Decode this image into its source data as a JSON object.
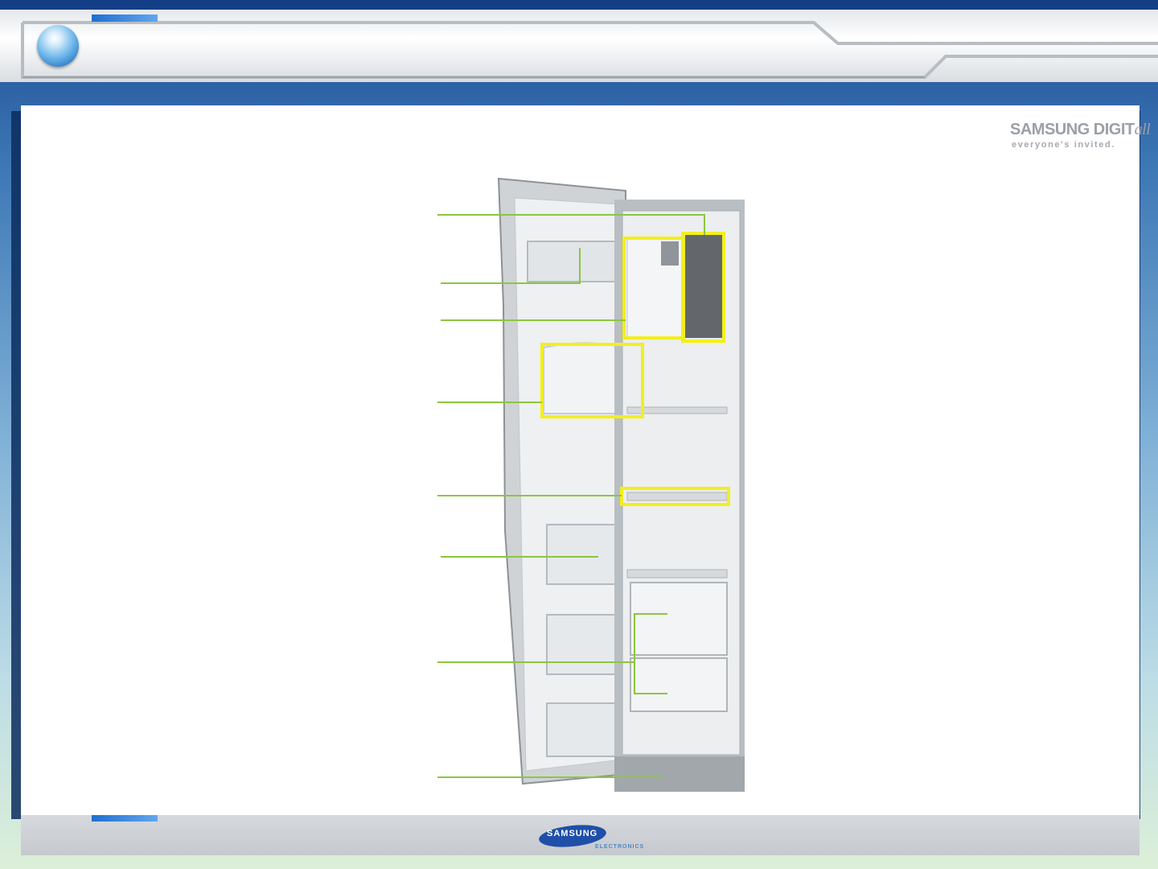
{
  "slide": {
    "title": "",
    "colors": {
      "frame_blue": "#1c4d96",
      "accent_blue": "#1f6fd1",
      "callout_line": "#8cc63f",
      "highlight_box": "#f2ef1c"
    },
    "header_icon": "globe-orb-icon"
  },
  "brand": {
    "main": "SAMSUNG DIGIT",
    "suffix": "all",
    "tagline": "everyone's invited."
  },
  "footer": {
    "logo_text": "SAMSUNG",
    "logo_sub": "ELECTRONICS"
  },
  "figure": {
    "subject": "fridge-compartment-photo",
    "callout_count": 8,
    "highlight_count": 4
  }
}
